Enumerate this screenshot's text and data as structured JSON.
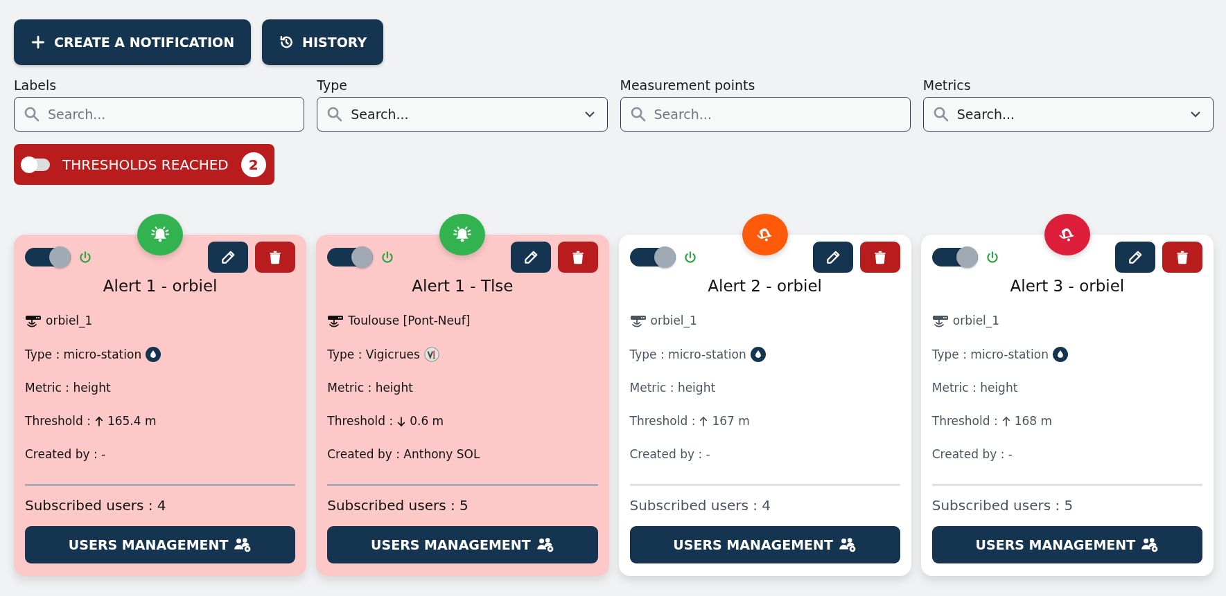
{
  "actions": [
    {
      "kind": "create",
      "label": "CREATE A NOTIFICATION"
    },
    {
      "kind": "history",
      "label": "HISTORY"
    }
  ],
  "filters": [
    {
      "label": "Labels",
      "kind": "search",
      "placeholder": "Search..."
    },
    {
      "label": "Type",
      "kind": "select",
      "placeholder": "Search..."
    },
    {
      "label": "Measurement points",
      "kind": "search",
      "placeholder": "Search..."
    },
    {
      "label": "Metrics",
      "kind": "select",
      "placeholder": "Search..."
    }
  ],
  "thresholds_filter": {
    "label": "THRESHOLDS REACHED",
    "count": "2",
    "on": false
  },
  "alerts": [
    {
      "title": "Alert 1 - orbiel",
      "enabled": true,
      "reached": true,
      "badge": {
        "kind": "ringing",
        "color": "#33b34f"
      },
      "station": "orbiel_1",
      "type": "Type : micro-station",
      "type_icon": {
        "kind": "drop"
      },
      "metric": "Metric : height",
      "threshold_label": "Threshold :",
      "arrow": {
        "kind": "up"
      },
      "threshold": "165.4 m",
      "created_by": "Created by : -",
      "subscribed": "Subscribed users : 4",
      "manage": "USERS MANAGEMENT"
    },
    {
      "title": "Alert 1 - Tlse",
      "enabled": true,
      "reached": true,
      "badge": {
        "kind": "ringing",
        "color": "#33b34f"
      },
      "station": "Toulouse [Pont-Neuf]",
      "type": "Type : Vigicrues",
      "type_icon": {
        "kind": "vigicrues"
      },
      "metric": "Metric : height",
      "threshold_label": "Threshold :",
      "arrow": {
        "kind": "down"
      },
      "threshold": "0.6 m",
      "created_by": "Created by : Anthony SOL",
      "subscribed": "Subscribed users : 5",
      "manage": "USERS MANAGEMENT"
    },
    {
      "title": "Alert 2 - orbiel",
      "enabled": true,
      "reached": false,
      "badge": {
        "kind": "muted",
        "color": "#ff5a0a"
      },
      "station": "orbiel_1",
      "type": "Type : micro-station",
      "type_icon": {
        "kind": "drop"
      },
      "metric": "Metric : height",
      "threshold_label": "Threshold :",
      "arrow": {
        "kind": "up"
      },
      "threshold": "167 m",
      "created_by": "Created by : -",
      "subscribed": "Subscribed users : 4",
      "manage": "USERS MANAGEMENT"
    },
    {
      "title": "Alert 3 - orbiel",
      "enabled": true,
      "reached": false,
      "badge": {
        "kind": "muted",
        "color": "#dc1e3a"
      },
      "station": "orbiel_1",
      "type": "Type : micro-station",
      "type_icon": {
        "kind": "drop"
      },
      "metric": "Metric : height",
      "threshold_label": "Threshold :",
      "arrow": {
        "kind": "up"
      },
      "threshold": "168 m",
      "created_by": "Created by : -",
      "subscribed": "Subscribed users : 5",
      "manage": "USERS MANAGEMENT"
    }
  ]
}
